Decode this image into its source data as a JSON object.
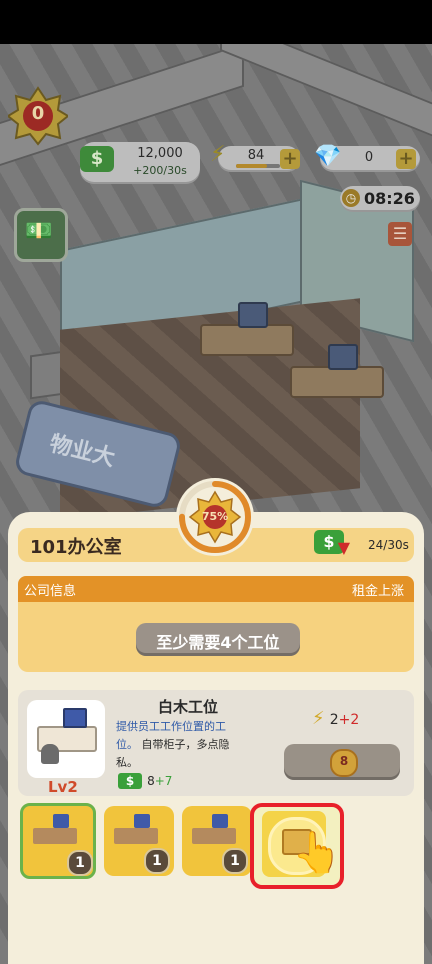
{
  "hud": {
    "level": "0",
    "money": "12,000",
    "money_rate": "+200/30s",
    "energy": "84",
    "gems": "0",
    "timer": "08:26"
  },
  "scene": {
    "sign_text": "物业大"
  },
  "room": {
    "progress": "75%",
    "progress_value": 0.75,
    "name": "101办公室",
    "rent_rate": "24/30s"
  },
  "info": {
    "header_left": "公司信息",
    "header_right": "租金上涨",
    "requirement": "至少需要4个工位"
  },
  "item": {
    "name": "白木工位",
    "desc_highlight": "提供员工工作位置的工位。",
    "desc_rest": "自带柜子，多点隐私。",
    "level": "Lv2",
    "income_base": "8",
    "income_bonus": "+7",
    "energy_base": "2",
    "energy_bonus": "+2",
    "cost": "8"
  },
  "slots": [
    {
      "count": "1"
    },
    {
      "count": "1"
    },
    {
      "count": "1"
    }
  ],
  "colors": {
    "accent_orange": "#e39227",
    "panel": "#f4eedb",
    "highlight_red": "#e8202a",
    "bonus_green": "#3aa03a"
  }
}
